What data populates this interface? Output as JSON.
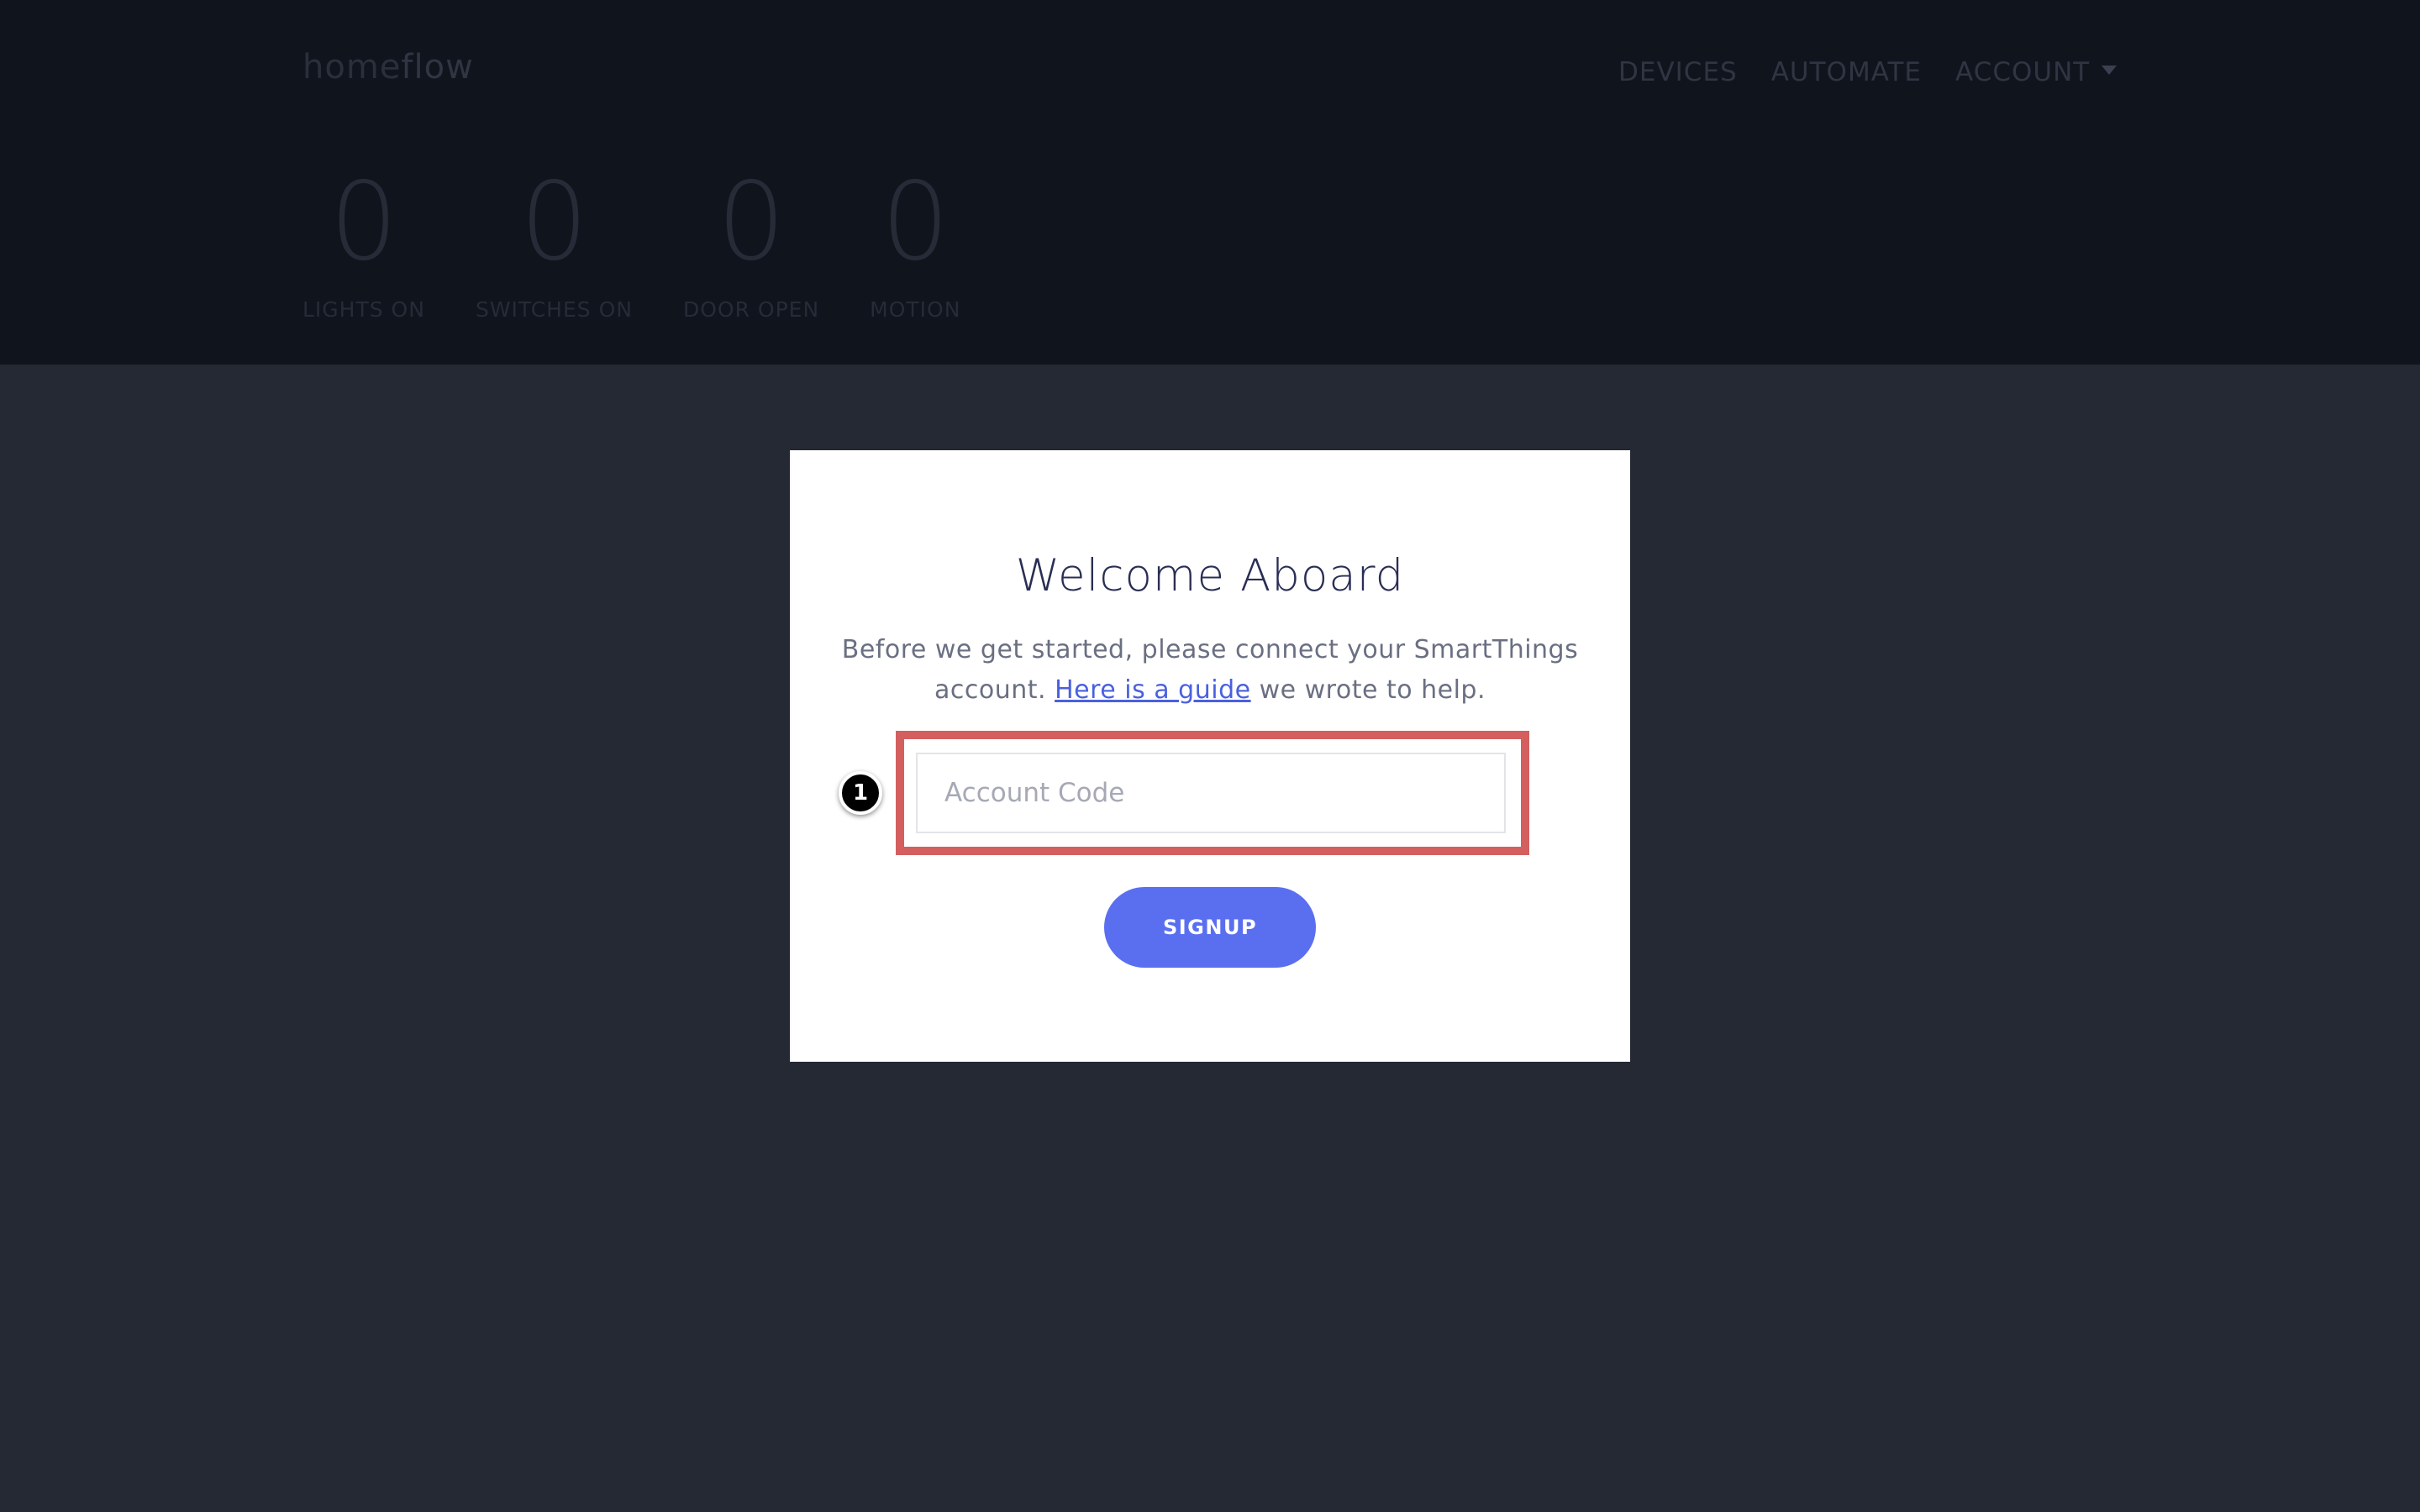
{
  "header": {
    "logo": {
      "light": "home",
      "bold": "flow"
    },
    "nav": {
      "devices": "DEVICES",
      "automate": "AUTOMATE",
      "account": "ACCOUNT",
      "account_icon": "caret-down-icon"
    },
    "stats": [
      {
        "value": "0",
        "label": "LIGHTS ON"
      },
      {
        "value": "0",
        "label": "SWITCHES ON"
      },
      {
        "value": "0",
        "label": "DOOR OPEN"
      },
      {
        "value": "0",
        "label": "MOTION"
      }
    ]
  },
  "card": {
    "title": "Welcome Aboard",
    "desc_before": "Before we get started, please connect your SmartThings account. ",
    "desc_link": "Here is a guide",
    "desc_after": " we wrote to help.",
    "input": {
      "placeholder": "Account Code",
      "value": ""
    },
    "step_badge": "1",
    "signup_label": "SIGNUP"
  },
  "colors": {
    "header_bg": "#10141d",
    "page_bg": "#252934",
    "accent": "#5a6ff0",
    "highlight": "#d45f5f",
    "link": "#4a61dd"
  }
}
